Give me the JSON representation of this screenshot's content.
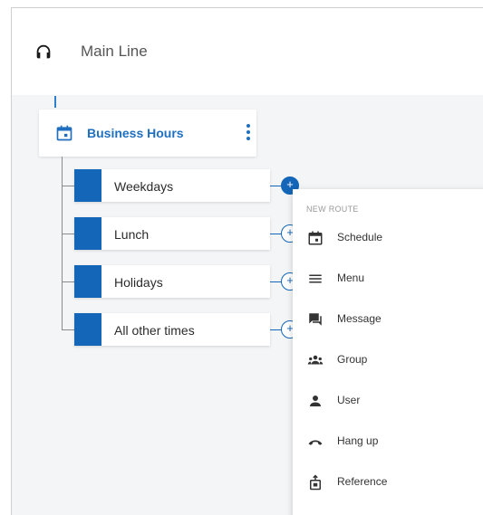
{
  "header": {
    "title": "Main Line",
    "icon": "headset-icon"
  },
  "schedule_node": {
    "label": "Business Hours",
    "icon": "calendar-icon",
    "menu_icon": "more-vert-icon",
    "accent": "#1e6fbf"
  },
  "routes": [
    {
      "label": "Weekdays",
      "active": true
    },
    {
      "label": "Lunch",
      "active": false
    },
    {
      "label": "Holidays",
      "active": false
    },
    {
      "label": "All other times",
      "active": false
    }
  ],
  "new_route_menu": {
    "heading": "NEW ROUTE",
    "items": [
      {
        "label": "Schedule",
        "icon": "calendar-icon"
      },
      {
        "label": "Menu",
        "icon": "menu-icon"
      },
      {
        "label": "Message",
        "icon": "message-icon"
      },
      {
        "label": "Group",
        "icon": "group-icon"
      },
      {
        "label": "User",
        "icon": "user-icon"
      },
      {
        "label": "Hang up",
        "icon": "hang-up-icon"
      },
      {
        "label": "Reference",
        "icon": "reference-icon"
      }
    ]
  },
  "colors": {
    "brand_blue": "#1466b8",
    "canvas_bg": "#f3f5f7"
  }
}
